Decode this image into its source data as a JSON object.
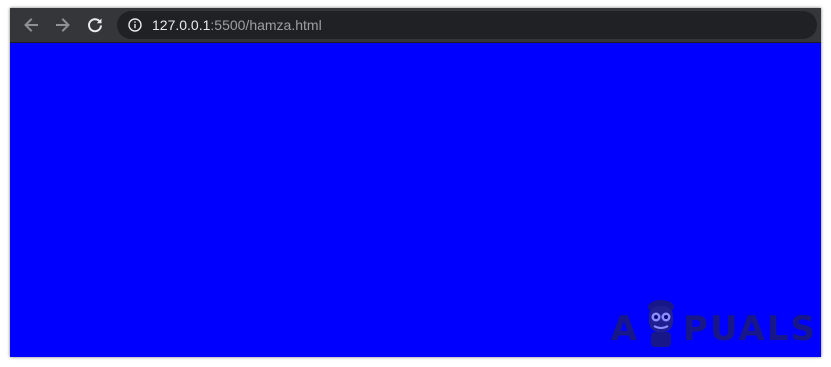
{
  "browser": {
    "address_bar": {
      "host": "127.0.0.1",
      "rest": ":5500/hamza.html"
    },
    "icons": {
      "back": "arrow-left-icon",
      "forward": "arrow-right-icon",
      "reload": "reload-icon",
      "site_info": "info-circle-icon"
    }
  },
  "page": {
    "background_color": "#0000ff",
    "text": ""
  },
  "watermark": {
    "left": "A",
    "right": "PUALS"
  },
  "colors": {
    "toolbar": "#35363a",
    "omnibox": "#202124",
    "url_host": "#e8eaed",
    "url_rest": "#9aa0a6"
  }
}
